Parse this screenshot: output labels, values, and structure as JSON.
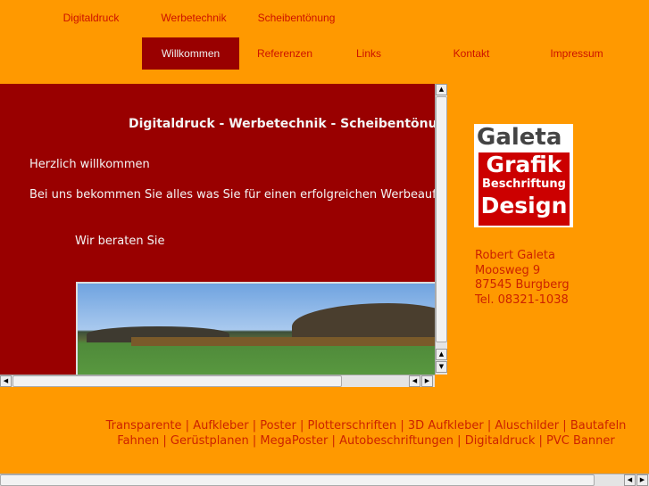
{
  "nav_top": [
    "Digitaldruck",
    "Werbetechnik",
    "Scheibentönung"
  ],
  "nav_main": [
    "Willkommen",
    "Referenzen",
    "Links",
    "Kontakt",
    "Impressum"
  ],
  "content": {
    "heading": "Digitaldruck - Werbetechnik -  Scheibentönung",
    "greeting": "Herzlich willkommen",
    "intro": "Bei uns bekommen Sie alles was Sie für einen erfolgreichen Werbeauftritt",
    "advice": "Wir beraten Sie"
  },
  "logo": {
    "line1": "Galeta",
    "line2": "Grafik",
    "line3": "Beschriftung",
    "line4": "Design"
  },
  "address": [
    "Robert Galeta",
    "Moosweg 9",
    "87545 Burgberg",
    "Tel. 08321-1038"
  ],
  "footer": {
    "row1": [
      "Transparente",
      "Aufkleber",
      "Poster",
      "Plotterschriften",
      "3D Aufkleber",
      "Aluschilder",
      "Bautafeln"
    ],
    "row2": [
      "Fahnen",
      "Gerüstplanen",
      "MegaPoster",
      "Autobeschriftungen",
      "Digitaldruck",
      "PVC Banner"
    ],
    "separator": " | "
  },
  "colors": {
    "background": "#FF9900",
    "accent": "#990000",
    "link": "#CC2200"
  }
}
